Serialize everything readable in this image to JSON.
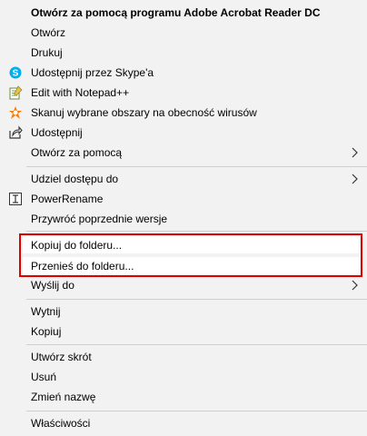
{
  "menu": {
    "items": [
      {
        "label": "Otwórz za pomocą programu Adobe Acrobat Reader DC"
      },
      {
        "label": "Otwórz"
      },
      {
        "label": "Drukuj"
      },
      {
        "label": "Udostępnij przez Skype'a",
        "icon": "skype-icon"
      },
      {
        "label": "Edit with Notepad++",
        "icon": "notepad-plus-plus-icon"
      },
      {
        "label": "Skanuj wybrane obszary na obecność wirusów",
        "icon": "avast-icon"
      },
      {
        "label": "Udostępnij",
        "icon": "share-icon"
      },
      {
        "label": "Otwórz za pomocą",
        "icon": "chevron-right-icon"
      },
      {
        "label": "Udziel dostępu do",
        "icon": "chevron-right-icon"
      },
      {
        "label": "PowerRename",
        "icon": "powerrename-icon"
      },
      {
        "label": "Przywróć poprzednie wersje"
      },
      {
        "label": "Kopiuj do folderu..."
      },
      {
        "label": "Przenieś do folderu..."
      },
      {
        "label": "Wyślij do",
        "icon": "chevron-right-icon"
      },
      {
        "label": "Wytnij"
      },
      {
        "label": "Kopiuj"
      },
      {
        "label": "Utwórz skrót"
      },
      {
        "label": "Usuń"
      },
      {
        "label": "Zmień nazwę"
      },
      {
        "label": "Właściwości"
      }
    ]
  },
  "colors": {
    "highlight_border": "#e00000",
    "skype": "#00aff0",
    "avast": "#ff7800"
  }
}
